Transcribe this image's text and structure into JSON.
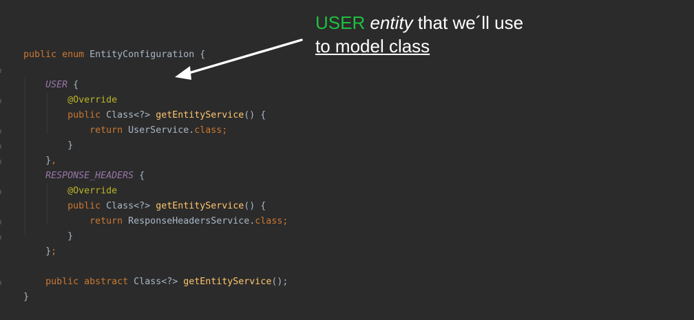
{
  "code": {
    "line1": {
      "kw1": "public",
      "kw2": "enum",
      "name": "EntityConfiguration",
      "brace": " {"
    },
    "line3": {
      "constant": "USER",
      "brace": " {"
    },
    "line4": {
      "annotation": "@Override"
    },
    "line5": {
      "kw": "public",
      "type": " Class<?> ",
      "fn": "getEntityService",
      "rest": "() {"
    },
    "line6": {
      "kw": "return",
      "value": " UserService.",
      "cls": "class",
      "end": ";"
    },
    "line7": {
      "brace": "}"
    },
    "line8": {
      "brace": "}",
      "comma": ","
    },
    "line9": {
      "constant": "RESPONSE_HEADERS",
      "brace": " {"
    },
    "line10": {
      "annotation": "@Override"
    },
    "line11": {
      "kw": "public",
      "type": " Class<?> ",
      "fn": "getEntityService",
      "rest": "() {"
    },
    "line12": {
      "kw": "return",
      "value": " ResponseHeadersService.",
      "cls": "class",
      "end": ";"
    },
    "line13": {
      "brace": "}"
    },
    "line14": {
      "brace": "}",
      "semi": ";"
    },
    "line16": {
      "kw1": "public",
      "kw2": "abstract",
      "type": " Class<?> ",
      "fn": "getEntityService",
      "rest": "();"
    },
    "line17": {
      "brace": "}"
    }
  },
  "annotation": {
    "highlight": "USER",
    "italic_word": "entity",
    "rest_line1": "that we´ll use",
    "line2": "to model class",
    "highlight_color": "#20c040",
    "text_color": "#ffffff"
  },
  "colors": {
    "background": "#2b2b2b",
    "keyword": "#cc7832",
    "function": "#ffc66d",
    "annotation": "#bbb529",
    "constant": "#9876aa",
    "plain": "#a9b7c6"
  }
}
